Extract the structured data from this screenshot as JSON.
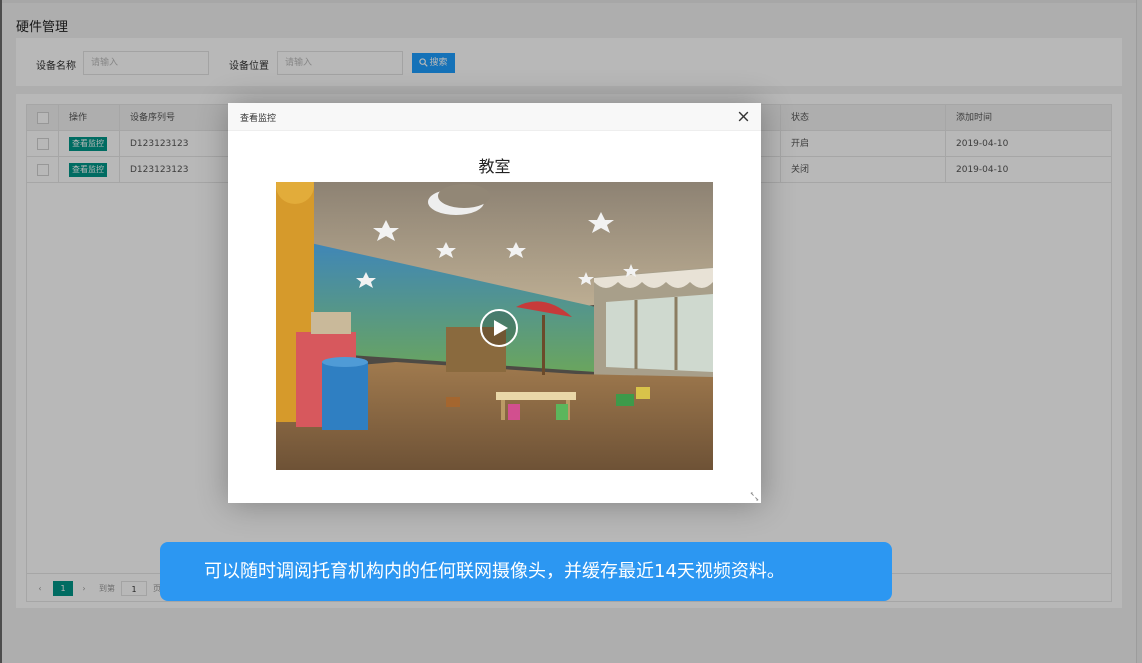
{
  "page": {
    "title": "硬件管理"
  },
  "search": {
    "name_label": "设备名称",
    "name_placeholder": "请输入",
    "location_label": "设备位置",
    "location_placeholder": "请输入",
    "button_label": "搜索"
  },
  "table": {
    "headers": {
      "action": "操作",
      "serial": "设备序列号",
      "status": "状态",
      "added": "添加时间"
    },
    "rows": [
      {
        "action": "查看监控",
        "serial": "D123123123",
        "status": "开启",
        "added": "2019-04-10"
      },
      {
        "action": "查看监控",
        "serial": "D123123123",
        "status": "关闭",
        "added": "2019-04-10"
      }
    ]
  },
  "pagination": {
    "prev": "‹",
    "current": "1",
    "next": "›",
    "goto_label": "到第",
    "page_input": "1",
    "page_suffix": "页"
  },
  "modal": {
    "title": "查看监控",
    "room": "教室",
    "close_icon": "close-icon",
    "play_icon": "play-icon"
  },
  "caption": {
    "text": "可以随时调阅托育机构内的任何联网摄像头，并缓存最近14天视频资料。"
  },
  "colors": {
    "primary": "#009688",
    "search_button": "#1e9fff",
    "caption_bg": "#2c97f2"
  }
}
